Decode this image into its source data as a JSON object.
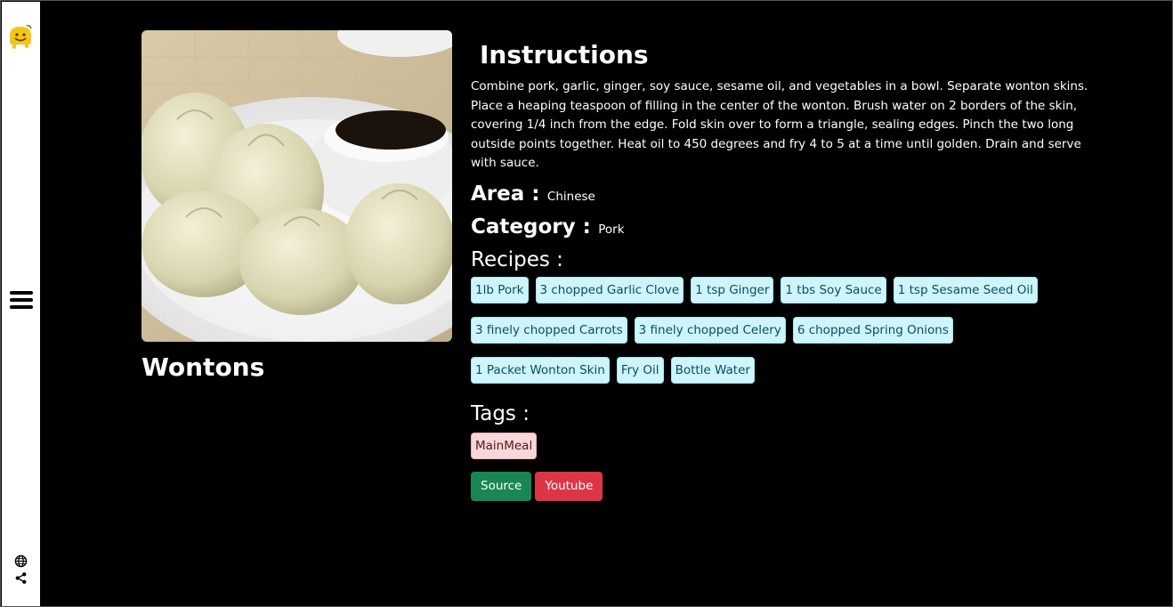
{
  "meal": {
    "title": "Wontons",
    "image_alt": "Wontons"
  },
  "instructions": {
    "heading": "Instructions",
    "text": "Combine pork, garlic, ginger, soy sauce, sesame oil, and vegetables in a bowl. Separate wonton skins. Place a heaping teaspoon of filling in the center of the wonton. Brush water on 2 borders of the skin, covering 1/4 inch from the edge. Fold skin over to form a triangle, sealing edges. Pinch the two long outside points together. Heat oil to 450 degrees and fry 4 to 5 at a time until golden. Drain and serve with sauce."
  },
  "area": {
    "label": "Area :",
    "value": "Chinese"
  },
  "category": {
    "label": "Category :",
    "value": "Pork"
  },
  "recipes": {
    "heading": "Recipes :",
    "items": [
      "1lb Pork",
      "3 chopped Garlic Clove",
      "1 tsp Ginger",
      "1 tbs Soy Sauce",
      "1 tsp Sesame Seed Oil",
      "3 finely chopped Carrots",
      "3 finely chopped Celery",
      "6 chopped Spring Onions",
      "1 Packet Wonton Skin",
      "Fry Oil",
      "Bottle Water"
    ]
  },
  "tags": {
    "heading": "Tags :",
    "items": [
      "MainMeal"
    ]
  },
  "buttons": {
    "source": "Source",
    "youtube": "Youtube"
  },
  "sidebar": {
    "icons": [
      "logo-icon",
      "menu-icon",
      "globe-icon",
      "share-icon"
    ]
  },
  "colors": {
    "background": "#000000",
    "sidebar": "#ffffff",
    "chip_bg": "#cff4fc",
    "chip_text": "#055160",
    "tag_bg": "#f8d7da",
    "source_btn": "#198754",
    "youtube_btn": "#dc3545"
  }
}
